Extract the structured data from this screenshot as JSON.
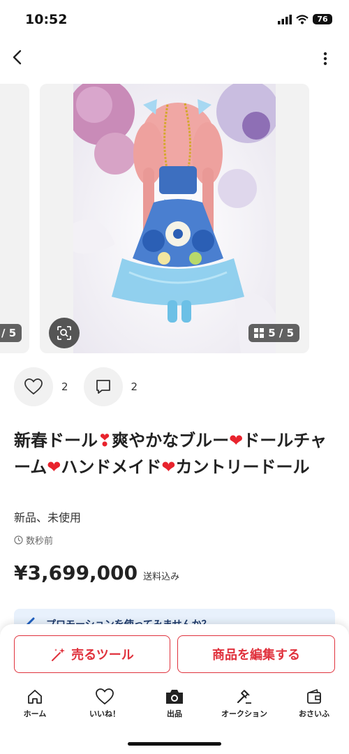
{
  "status_bar": {
    "time": "10:52",
    "battery": "76"
  },
  "gallery": {
    "prev_counter": "/ 5",
    "main_counter": "5 / 5"
  },
  "actions": {
    "likes": "2",
    "comments": "2"
  },
  "item": {
    "title_1": "新春ドール",
    "title_2": "爽やかなブルー",
    "title_3": "ドールチャーム",
    "title_4": "ハンドメイド",
    "title_5": "カントリードール",
    "condition": "新品、未使用",
    "posted": "数秒前",
    "price": "¥3,699,000",
    "shipping": "送料込み"
  },
  "promo": {
    "text": "プロモーションを使ってみませんか？"
  },
  "buttons": {
    "sell_tool": "売るツール",
    "edit_item": "商品を編集する"
  },
  "tabs": [
    {
      "label": "ホーム",
      "icon": "home-icon"
    },
    {
      "label": "いいね！",
      "icon": "heart-icon"
    },
    {
      "label": "出品",
      "icon": "camera-icon"
    },
    {
      "label": "オークション",
      "icon": "gavel-icon"
    },
    {
      "label": "おさいふ",
      "icon": "wallet-icon"
    }
  ],
  "colors": {
    "accent": "#e0323d",
    "heart": "#e8232d",
    "promo_bg": "#e8f1fc"
  }
}
